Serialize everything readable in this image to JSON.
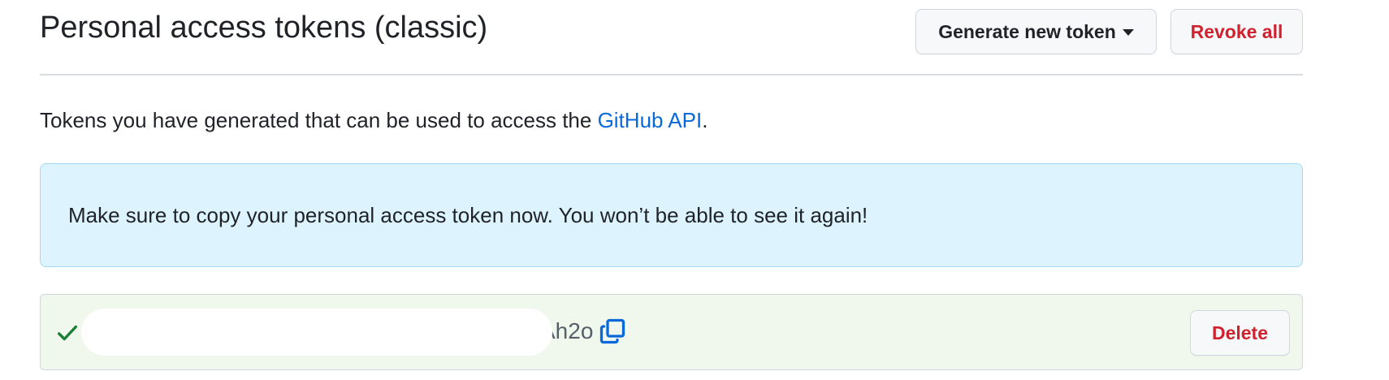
{
  "header": {
    "title": "Personal access tokens (classic)",
    "generate_label": "Generate new token",
    "revoke_label": "Revoke all"
  },
  "intro": {
    "text_before": "Tokens you have generated that can be used to access the ",
    "link_text": "GitHub API",
    "text_after": "."
  },
  "flash": {
    "message": "Make sure to copy your personal access token now. You won’t be able to see it again!"
  },
  "token": {
    "visible_suffix": "Ah2o",
    "delete_label": "Delete",
    "status_icon": "check-icon",
    "copy_icon": "copy-icon"
  },
  "colors": {
    "danger": "#cf222e",
    "link": "#0969da",
    "info_bg": "#ddf4ff",
    "success_bg": "#f0f7ec",
    "success_icon": "#1a7f37"
  }
}
